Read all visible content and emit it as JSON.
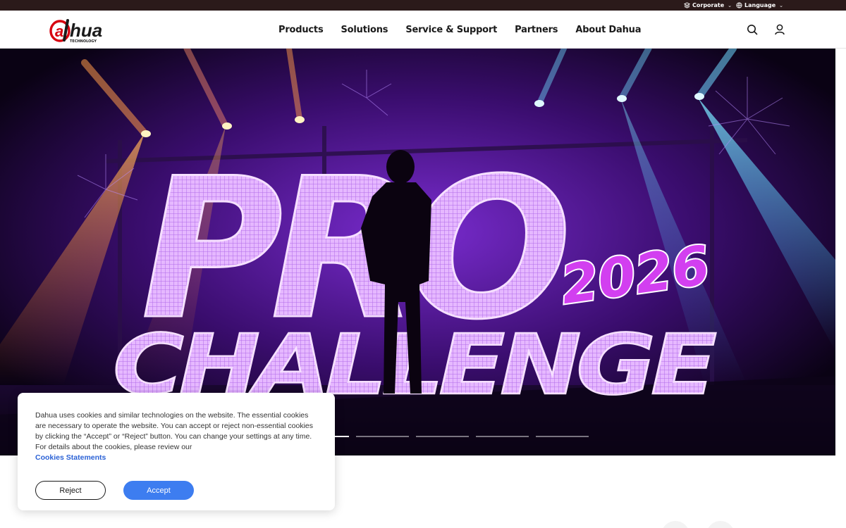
{
  "topbar": {
    "corporate_label": "Corporate",
    "language_label": "Language"
  },
  "header": {
    "logo_text": "alhua",
    "logo_subtext": "TECHNOLOGY",
    "nav": [
      "Products",
      "Solutions",
      "Service & Support",
      "Partners",
      "About Dahua"
    ]
  },
  "hero": {
    "headline_line1": "PRO",
    "headline_year": "2026",
    "headline_line2": "CHALLENGE",
    "slides_total": 5,
    "active_slide": 1
  },
  "cookie_banner": {
    "text": "Dahua uses cookies and similar technologies on the website. The essential cookies are necessary to operate the website. You can accept or reject non-essential cookies by clicking the “Accept” or “Reject” button. You can change your settings at any time. For details about the cookies, please review our",
    "link_label": "Cookies Statements",
    "reject_label": "Reject",
    "accept_label": "Accept"
  },
  "colors": {
    "brand_red": "#d7000f",
    "accent_blue": "#3d7df0",
    "hero_purple": "#6a1fb8",
    "topbar_bg": "#2b1a1a"
  }
}
